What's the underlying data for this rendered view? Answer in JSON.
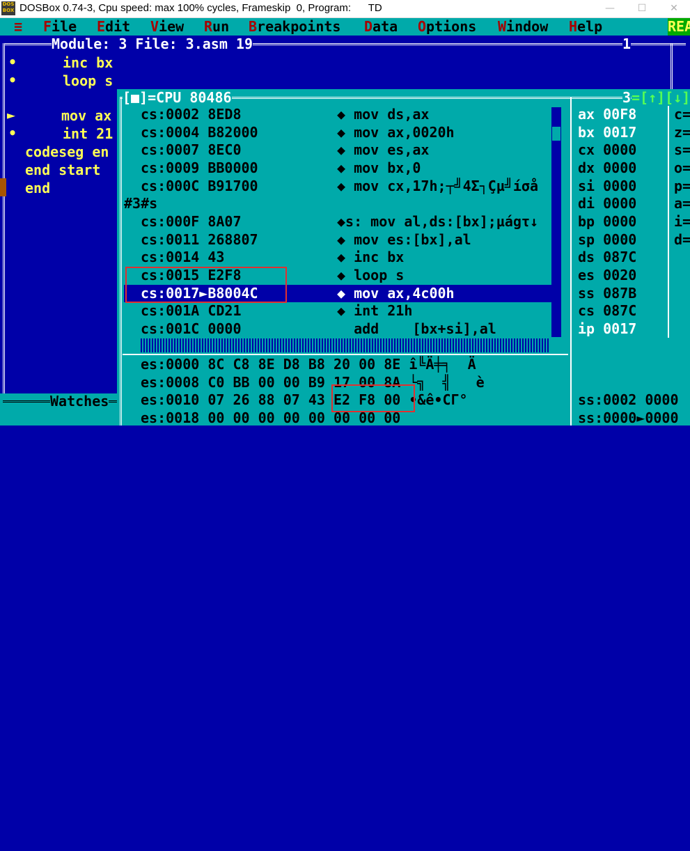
{
  "window": {
    "title": "DOSBox 0.74-3, Cpu speed: max 100% cycles, Frameskip  0, Program:      TD",
    "icon_text_top": "DOS",
    "icon_text_bottom": "BOX",
    "controls": {
      "minimize": "—",
      "maximize": "☐",
      "close": "✕"
    }
  },
  "menubar": {
    "system": "≡",
    "items": [
      {
        "hk": "F",
        "rest": "ile"
      },
      {
        "hk": "E",
        "rest": "dit"
      },
      {
        "hk": "V",
        "rest": "iew"
      },
      {
        "hk": "R",
        "rest": "un"
      },
      {
        "hk": "B",
        "rest": "reakpoints"
      },
      {
        "hk": "D",
        "rest": "ata"
      },
      {
        "hk": "O",
        "rest": "ptions"
      },
      {
        "hk": "W",
        "rest": "indow"
      },
      {
        "hk": "H",
        "rest": "elp"
      }
    ],
    "status": "READY"
  },
  "module": {
    "title": "Module: 3 File: 3.asm 19",
    "number": "1",
    "lines": [
      "inc bx",
      "loop s",
      "",
      "mov ax",
      "int 21",
      "codeseg en",
      "end start",
      "end"
    ],
    "bullets": [
      "•",
      "•",
      "",
      "►",
      "•"
    ]
  },
  "watches": {
    "title": "Watches"
  },
  "cpu": {
    "title": "[■]=CPU 80486",
    "number": "3",
    "arrows": "=[↑][↓]",
    "code": [
      {
        "addr": "cs:0002",
        "bytes": "8ED8",
        "instr": "◆ mov ds,ax"
      },
      {
        "addr": "cs:0004",
        "bytes": "B82000",
        "instr": "◆ mov ax,0020h"
      },
      {
        "addr": "cs:0007",
        "bytes": "8EC0",
        "instr": "◆ mov es,ax"
      },
      {
        "addr": "cs:0009",
        "bytes": "BB0000",
        "instr": "◆ mov bx,0"
      },
      {
        "addr": "cs:000C",
        "bytes": "B91700",
        "instr": "◆ mov cx,17h;┬╝4Σ┐Çµ╝íσå"
      },
      {
        "label": "#3#s"
      },
      {
        "addr": "cs:000F",
        "bytes": "8A07",
        "instr": "◆s: mov al,ds:[bx];µágτ↓"
      },
      {
        "addr": "cs:0011",
        "bytes": "268807",
        "instr": "◆ mov es:[bx],al"
      },
      {
        "addr": "cs:0014",
        "bytes": "43",
        "instr": "◆ inc bx"
      },
      {
        "addr": "cs:0015",
        "bytes": "E2F8",
        "instr": "◆ loop s"
      },
      {
        "addr": "cs:0017",
        "bytes": "►B8004C",
        "instr": "◆ mov ax,4c00h"
      },
      {
        "addr": "cs:001A",
        "bytes": "CD21",
        "instr": "◆ int 21h"
      },
      {
        "addr": "cs:001C",
        "bytes": "0000",
        "instr": "  add    [bx+si],al"
      }
    ],
    "registers": [
      {
        "name": "ax",
        "value": "00F8"
      },
      {
        "name": "bx",
        "value": "0017"
      },
      {
        "name": "cx",
        "value": "0000"
      },
      {
        "name": "dx",
        "value": "0000"
      },
      {
        "name": "si",
        "value": "0000"
      },
      {
        "name": "di",
        "value": "0000"
      },
      {
        "name": "bp",
        "value": "0000"
      },
      {
        "name": "sp",
        "value": "0000"
      },
      {
        "name": "ds",
        "value": "087C"
      },
      {
        "name": "es",
        "value": "0020"
      },
      {
        "name": "ss",
        "value": "087B"
      },
      {
        "name": "cs",
        "value": "087C"
      },
      {
        "name": "ip",
        "value": "0017"
      }
    ],
    "flags": [
      "c=",
      "z=",
      "s=",
      "o=",
      "p=",
      "a=",
      "i=",
      "d="
    ],
    "dump": [
      "es:0000 8C C8 8E D8 B8 20 00 8E î╚Ä╪╕  Ä",
      "es:0008 C0 BB 00 00 B9 17 00 8A └╗  ╣   è",
      "es:0010 07 26 88 07 43 E2 F8 00 •&ê•CΓ°",
      "es:0018 00 00 00 00 00 00 00 00"
    ],
    "stack": [
      "ss:0002 0000",
      "ss:0000►0000"
    ]
  }
}
